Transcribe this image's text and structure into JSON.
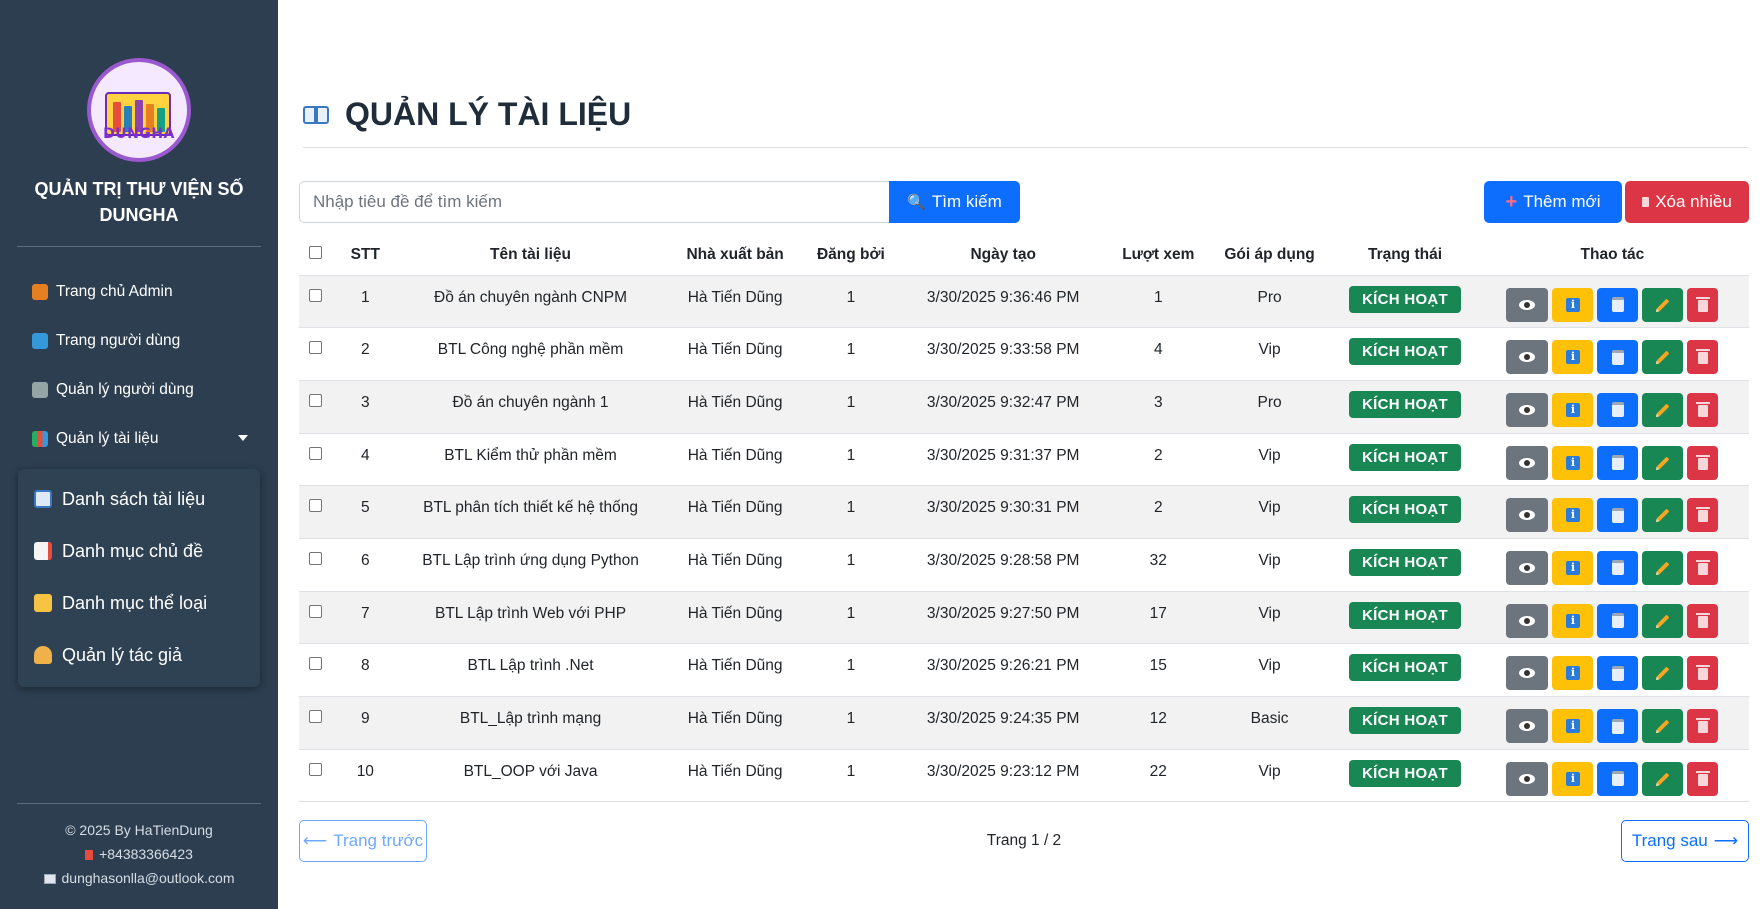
{
  "sidebar": {
    "logo_text": "DUNGHA",
    "brand_line1": "QUẢN TRỊ THƯ VIỆN SỐ",
    "brand_line2": "DUNGHA",
    "items": [
      {
        "label": "Trang chủ Admin",
        "icon": "house-icon"
      },
      {
        "label": "Trang người dùng",
        "icon": "refresh-icon"
      },
      {
        "label": "Quản lý người dùng",
        "icon": "users-icon"
      },
      {
        "label": "Quản lý tài liệu",
        "icon": "books-icon"
      }
    ],
    "submenu": [
      {
        "label": "Danh sách tài liệu",
        "icon": "open-book-icon"
      },
      {
        "label": "Danh mục chủ đề",
        "icon": "bookmark-page-icon"
      },
      {
        "label": "Danh mục thể loại",
        "icon": "folder-icon"
      },
      {
        "label": "Quản lý tác giả",
        "icon": "writing-hand-icon"
      }
    ],
    "footer": {
      "copyright": "© 2025 By HaTienDung",
      "phone": "+84383366423",
      "email": "dunghasonlla@outlook.com"
    }
  },
  "header": {
    "title": "QUẢN LÝ TÀI LIỆU"
  },
  "toolbar": {
    "search_placeholder": "Nhập tiêu đề để tìm kiếm",
    "search_label": "Tìm kiếm",
    "add_label": "Thêm mới",
    "delete_many_label": "Xóa nhiều"
  },
  "table": {
    "columns": [
      "STT",
      "Tên tài liệu",
      "Nhà xuất bản",
      "Đăng bởi",
      "Ngày tạo",
      "Lượt xem",
      "Gói áp dụng",
      "Trạng thái",
      "Thao tác"
    ],
    "rows": [
      {
        "stt": "1",
        "title": "Đồ án chuyên ngành CNPM",
        "publisher": "Hà Tiến Dũng",
        "posted_by": "1",
        "created": "3/30/2025 9:36:46 PM",
        "views": "1",
        "plan": "Pro",
        "status": "KÍCH HOẠT"
      },
      {
        "stt": "2",
        "title": "BTL Công nghệ phần mềm",
        "publisher": "Hà Tiến Dũng",
        "posted_by": "1",
        "created": "3/30/2025 9:33:58 PM",
        "views": "4",
        "plan": "Vip",
        "status": "KÍCH HOẠT"
      },
      {
        "stt": "3",
        "title": "Đồ án chuyên ngành 1",
        "publisher": "Hà Tiến Dũng",
        "posted_by": "1",
        "created": "3/30/2025 9:32:47 PM",
        "views": "3",
        "plan": "Pro",
        "status": "KÍCH HOẠT"
      },
      {
        "stt": "4",
        "title": "BTL Kiểm thử phần mềm",
        "publisher": "Hà Tiến Dũng",
        "posted_by": "1",
        "created": "3/30/2025 9:31:37 PM",
        "views": "2",
        "plan": "Vip",
        "status": "KÍCH HOẠT"
      },
      {
        "stt": "5",
        "title": "BTL phân tích thiết kế hệ thống",
        "publisher": "Hà Tiến Dũng",
        "posted_by": "1",
        "created": "3/30/2025 9:30:31 PM",
        "views": "2",
        "plan": "Vip",
        "status": "KÍCH HOẠT"
      },
      {
        "stt": "6",
        "title": "BTL Lập trình ứng dụng Python",
        "publisher": "Hà Tiến Dũng",
        "posted_by": "1",
        "created": "3/30/2025 9:28:58 PM",
        "views": "32",
        "plan": "Vip",
        "status": "KÍCH HOẠT"
      },
      {
        "stt": "7",
        "title": "BTL Lập trình Web với PHP",
        "publisher": "Hà Tiến Dũng",
        "posted_by": "1",
        "created": "3/30/2025 9:27:50 PM",
        "views": "17",
        "plan": "Vip",
        "status": "KÍCH HOẠT"
      },
      {
        "stt": "8",
        "title": "BTL Lập trình .Net",
        "publisher": "Hà Tiến Dũng",
        "posted_by": "1",
        "created": "3/30/2025 9:26:21 PM",
        "views": "15",
        "plan": "Vip",
        "status": "KÍCH HOẠT"
      },
      {
        "stt": "9",
        "title": "BTL_Lập trình mạng",
        "publisher": "Hà Tiến Dũng",
        "posted_by": "1",
        "created": "3/30/2025 9:24:35 PM",
        "views": "12",
        "plan": "Basic",
        "status": "KÍCH HOẠT"
      },
      {
        "stt": "10",
        "title": "BTL_OOP với Java",
        "publisher": "Hà Tiến Dũng",
        "posted_by": "1",
        "created": "3/30/2025 9:23:12 PM",
        "views": "22",
        "plan": "Vip",
        "status": "KÍCH HOẠT"
      }
    ],
    "row_actions": [
      "eye-icon",
      "info-icon",
      "clipboard-icon",
      "pencil-icon",
      "trash-icon"
    ]
  },
  "pagination": {
    "prev_label": "Trang trước",
    "next_label": "Trang sau",
    "page_info": "Trang 1 / 2"
  },
  "colors": {
    "sidebar_bg": "#2c3e50",
    "primary": "#0d6efd",
    "danger": "#dc3545",
    "success": "#198754",
    "warning": "#ffc107",
    "secondary": "#6c757d"
  }
}
